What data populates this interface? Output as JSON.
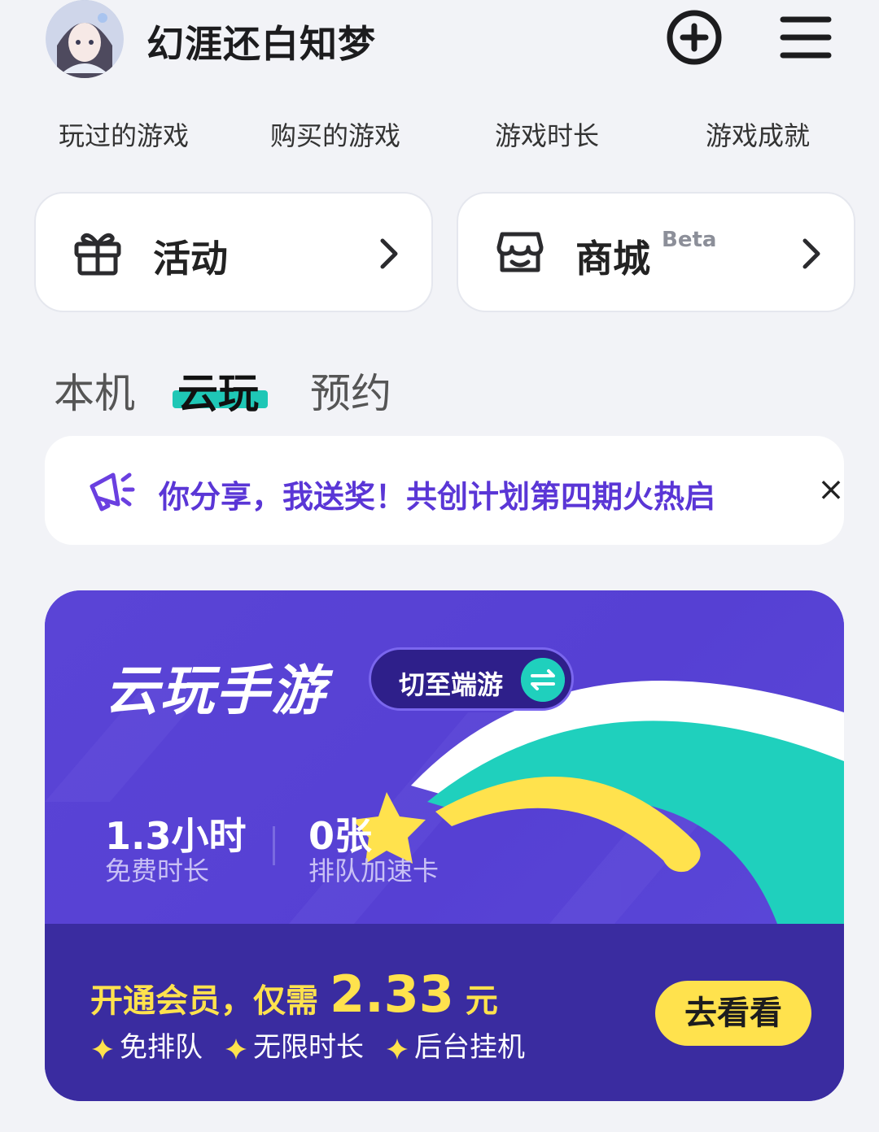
{
  "header": {
    "username": "幻涯还白知梦",
    "add_icon": "plus-circle-icon",
    "menu_icon": "hamburger-menu-icon"
  },
  "stat_links": [
    "玩过的游戏",
    "购买的游戏",
    "游戏时长",
    "游戏成就"
  ],
  "quick_cards": {
    "activity": {
      "label": "活动",
      "icon": "gift-icon"
    },
    "store": {
      "label": "商城",
      "badge": "Beta",
      "icon": "store-icon"
    }
  },
  "tabs": [
    {
      "label": "本机",
      "active": false
    },
    {
      "label": "云玩",
      "active": true
    },
    {
      "label": "预约",
      "active": false
    }
  ],
  "notice": {
    "text": "你分享，我送奖！共创计划第四期火热启",
    "close": "×",
    "icon": "megaphone-icon"
  },
  "cloud_card": {
    "title": "云玩手游",
    "switch_label": "切至端游",
    "switch_icon": "swap-arrows-icon",
    "free_time_value": "1.3小时",
    "free_time_label": "免费时长",
    "queue_card_value": "0张",
    "queue_card_label": "排队加速卡",
    "promo_prefix": "开通会员，仅需",
    "promo_price": "2.33",
    "promo_unit": "元",
    "perks": [
      "免排队",
      "无限时长",
      "后台挂机"
    ],
    "cta": "去看看"
  },
  "colors": {
    "accent_teal": "#1fc7b6",
    "card_purple": "#5a44d6",
    "card_dark": "#3a2ca0",
    "promo_yellow": "#ffe24d",
    "notice_purple": "#5a36d6"
  }
}
